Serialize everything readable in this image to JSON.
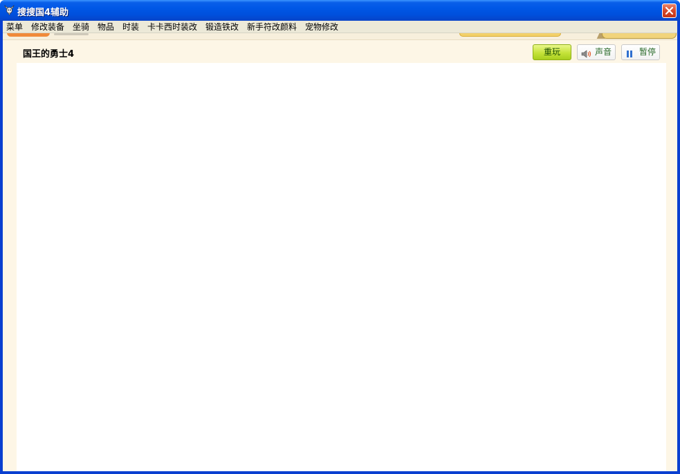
{
  "window": {
    "title": "搜搜国4辅助",
    "app_icon": "bull-skull-icon",
    "close_icon": "close-icon",
    "accent_color": "#0050dd",
    "close_color": "#d5482a"
  },
  "menu": {
    "items": [
      {
        "label": "菜单"
      },
      {
        "label": "修改装备"
      },
      {
        "label": "坐骑"
      },
      {
        "label": "物品"
      },
      {
        "label": "时装"
      },
      {
        "label": "卡卡西时装改"
      },
      {
        "label": "锻造铁改"
      },
      {
        "label": "新手符改颜料"
      },
      {
        "label": "宠物修改"
      }
    ]
  },
  "game": {
    "title": "国王的勇士4",
    "replay_label": "重玩",
    "sound_label": "声音",
    "sound_icon": "speaker-icon",
    "pause_label": "暂停",
    "pause_icon": "pause-icon",
    "replay_color": "#c5e33a"
  }
}
